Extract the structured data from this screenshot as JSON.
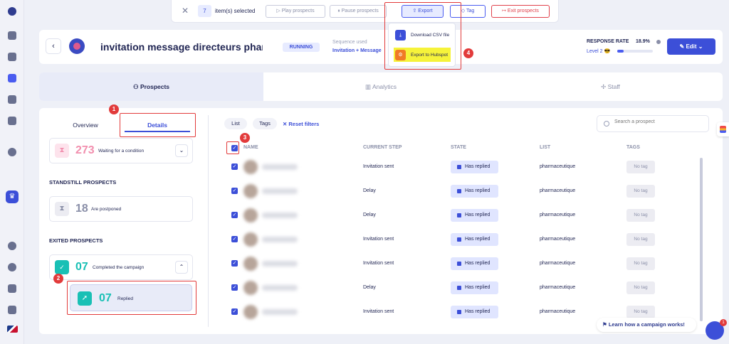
{
  "selection_toolbar": {
    "count": "7",
    "selected_label": "item(s) selected",
    "buttons": {
      "play": "Play prospects",
      "pause": "Pause prospects",
      "export": "Export",
      "tag": "Tag",
      "exit": "Exit prospects"
    }
  },
  "export_menu": {
    "items": [
      {
        "label": "Download CSV file",
        "icon": "download-icon"
      },
      {
        "label": "Export to Hubspot",
        "icon": "hubspot-icon"
      }
    ]
  },
  "header": {
    "campaign_title": "invitation message directeurs pharma",
    "status": "RUNNING",
    "sequence_label": "Sequence used",
    "sequence_value": "Invitation + Message",
    "response_rate_label": "RESPONSE RATE",
    "response_rate_value": "18.9%",
    "response_rate_fraction": 0.189,
    "level": "Level 2 😎",
    "edit_label": "Edit"
  },
  "main_tabs": [
    {
      "label": "Prospects",
      "icon": "users-icon",
      "active": true
    },
    {
      "label": "Analytics",
      "icon": "chart-icon",
      "active": false
    },
    {
      "label": "Staff",
      "icon": "staff-icon",
      "active": false
    }
  ],
  "left_panel": {
    "tabs": {
      "overview": "Overview",
      "details": "Details"
    },
    "waiting": {
      "count": "273",
      "label": "Waiting for a condition"
    },
    "standstill_title": "STANDSTILL PROSPECTS",
    "postponed": {
      "count": "18",
      "label": "Are postponed"
    },
    "exited_title": "EXITED PROSPECTS",
    "completed": {
      "count": "07",
      "label": "Completed the campaign"
    },
    "replied": {
      "count": "07",
      "label": "Replied"
    }
  },
  "filters": {
    "list": "List",
    "tags": "Tags",
    "reset": "Reset filters",
    "search_placeholder": "Search a prospect"
  },
  "table": {
    "headers": {
      "name": "NAME",
      "step": "CURRENT STEP",
      "state": "STATE",
      "list": "LIST",
      "tags": "TAGS"
    },
    "rows": [
      {
        "step": "Invitation sent",
        "state": "Has replied",
        "list": "pharmaceutique",
        "tag": "No tag"
      },
      {
        "step": "Delay",
        "state": "Has replied",
        "list": "pharmaceutique",
        "tag": "No tag"
      },
      {
        "step": "Delay",
        "state": "Has replied",
        "list": "pharmaceutique",
        "tag": "No tag"
      },
      {
        "step": "Invitation sent",
        "state": "Has replied",
        "list": "pharmaceutique",
        "tag": "No tag"
      },
      {
        "step": "Invitation sent",
        "state": "Has replied",
        "list": "pharmaceutique",
        "tag": "No tag"
      },
      {
        "step": "Delay",
        "state": "Has replied",
        "list": "pharmaceutique",
        "tag": "No tag"
      },
      {
        "step": "Invitation sent",
        "state": "Has replied",
        "list": "pharmaceutique",
        "tag": "No tag"
      }
    ]
  },
  "annotations": [
    "1",
    "2",
    "3",
    "4"
  ],
  "help": {
    "learn": "Learn how a campaign works!",
    "chat_badge": "1"
  },
  "colors": {
    "accent": "#3c4fd8",
    "teal": "#19c0b5",
    "pink": "#f28fae",
    "annotation_red": "#e23b3b",
    "highlight_yellow": "#f6f33a"
  }
}
